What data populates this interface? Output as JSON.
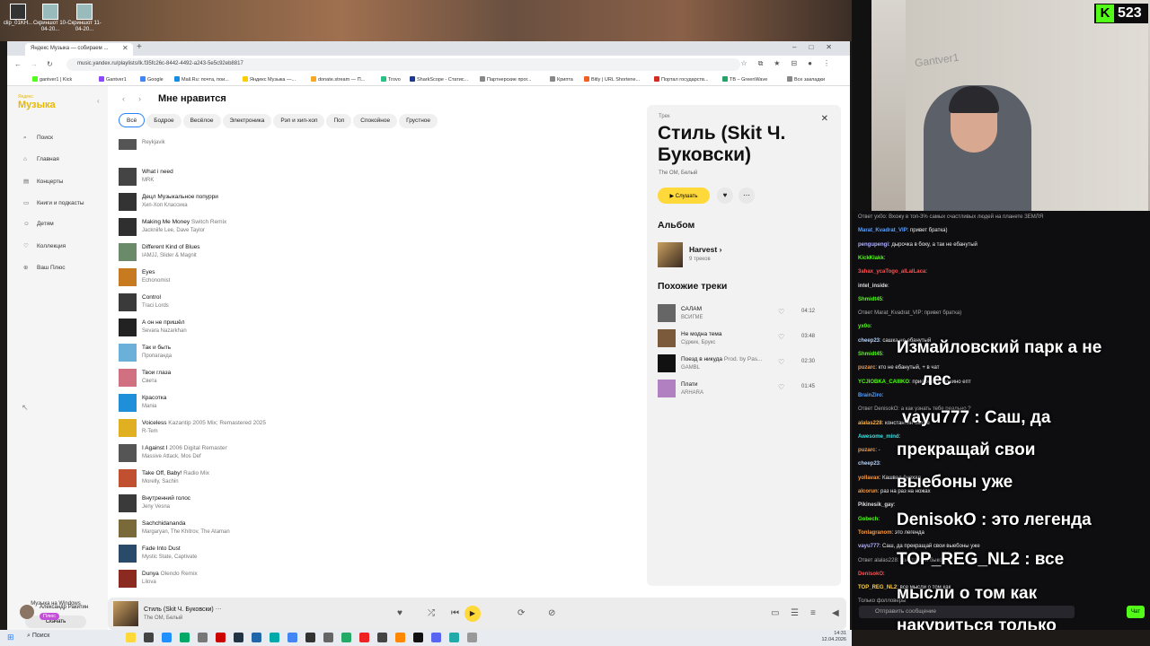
{
  "desktop": {
    "icons": [
      {
        "label": "clip_01KH..."
      },
      {
        "label": "Скриншот 10-04-20..."
      },
      {
        "label": "Скриншот 11-04-20..."
      }
    ]
  },
  "browser": {
    "tab_title": "Яндекс Музыка — собираем ...",
    "url": "music.yandex.ru/playlists/lk.f35fc26c-8442-4492-a243-5e5c92eb8817",
    "bookmarks": [
      "gantver1 | Kick",
      "Gantver1",
      "Google",
      "Mail.Ru: почта, пои...",
      "Яндекс Музыка —...",
      "donate.stream — П...",
      "Trovo",
      "SharkScope - Статис...",
      "Партнерские прог...",
      "Крипта",
      "Bitly | URL Shortene...",
      "Портал государств...",
      "TB – GreenWave",
      "Все закладки"
    ]
  },
  "sidebar": {
    "logo_top": "Яндекс",
    "logo": "Музыка",
    "items": [
      {
        "label": "Поиск",
        "icon": "search-icon"
      },
      {
        "label": "Главная",
        "icon": "home-icon"
      },
      {
        "label": "Концерты",
        "icon": "ticket-icon"
      },
      {
        "label": "Книги и подкасты",
        "icon": "book-icon"
      },
      {
        "label": "Детям",
        "icon": "kids-icon"
      },
      {
        "label": "Коллекция",
        "icon": "heart-icon"
      },
      {
        "label": "Ваш Плюс",
        "icon": "plus-icon"
      }
    ],
    "promo_text": "Музыка на Windows",
    "promo_button": "Скачать",
    "user_name": "Александр Ракитин",
    "user_badge": "Плюс"
  },
  "playlist": {
    "title": "Мне нравится",
    "filters": [
      "Всё",
      "Бодрое",
      "Весёлое",
      "Электроника",
      "Рэп и хип-хоп",
      "Поп",
      "Спокойное",
      "Грустное"
    ],
    "tracks": [
      {
        "title": "",
        "version": "",
        "artist": "Reykjavik",
        "color": "#555"
      },
      {
        "title": "What i need",
        "version": "",
        "artist": "MRK",
        "color": "#444"
      },
      {
        "title": "Децл Музыкальное попурри",
        "version": "",
        "artist": "Хип-Хоп Классика",
        "color": "#333"
      },
      {
        "title": "Making Me Money",
        "version": "Switch Remix",
        "artist": "Jackniife Lee, Dave Taylor",
        "color": "#2f2f2f"
      },
      {
        "title": "Different Kind of Blues",
        "version": "",
        "artist": "IAMJJ, Slider & Magnit",
        "color": "#6a8a6a"
      },
      {
        "title": "Eyes",
        "version": "",
        "artist": "Echonomist",
        "color": "#c87a20"
      },
      {
        "title": "Control",
        "version": "",
        "artist": "Traci Lords",
        "color": "#3a3a3a"
      },
      {
        "title": "А он не пришёл",
        "version": "",
        "artist": "Sevara Nazarkhan",
        "color": "#222"
      },
      {
        "title": "Так и быть",
        "version": "",
        "artist": "Пропаганда",
        "color": "#6ab0d8"
      },
      {
        "title": "Твои глаза",
        "version": "",
        "artist": "Света",
        "color": "#d07080"
      },
      {
        "title": "Красотка",
        "version": "",
        "artist": "Mania",
        "color": "#1e8fd8"
      },
      {
        "title": "Voiceless",
        "version": "Kazantip 2005 Mix; Remastered 2025",
        "artist": "R-Tem",
        "color": "#e0b020"
      },
      {
        "title": "I Against I",
        "version": "2006 Digital Remaster",
        "artist": "Massive Attack, Mos Def",
        "color": "#555"
      },
      {
        "title": "Take Off, Baby!",
        "version": "Radio Mix",
        "artist": "Morelly, Sachin",
        "color": "#c05030"
      },
      {
        "title": "Внутренний голос",
        "version": "",
        "artist": "Jeny Vesna",
        "color": "#3a3a3a"
      },
      {
        "title": "Sachchidananda",
        "version": "",
        "artist": "Margaryan, The Khitrov, The Ataman",
        "color": "#7a6a3a"
      },
      {
        "title": "Fade Into Dust",
        "version": "",
        "artist": "Mystic State, Captivate",
        "color": "#2a4a6a"
      },
      {
        "title": "Dunya",
        "version": "Olendo Remix",
        "artist": "Lilova",
        "color": "#8a2a20"
      }
    ]
  },
  "track_panel": {
    "tag": "Трек",
    "title": "Стиль (Skit Ч. Буковски)",
    "artists": "The OM, Белый",
    "listen": "▶ Слушать",
    "album_header": "Альбом",
    "album_name": "Harvest",
    "album_count": "9 треков",
    "similar_header": "Похожие треки",
    "similar": [
      {
        "title": "САЛАМ",
        "version": "",
        "artist": "ВСИГМЕ",
        "duration": "04:12",
        "color": "#666"
      },
      {
        "title": "Не модна тема",
        "version": "",
        "artist": "Сіджик, Брукс",
        "duration": "03:48",
        "color": "#7a5a3a"
      },
      {
        "title": "Поезд в никуда",
        "version": "Prod. by Pas...",
        "artist": "GAMBL",
        "duration": "02:30",
        "color": "#111"
      },
      {
        "title": "Плати",
        "version": "",
        "artist": "ARHARA",
        "duration": "01:45",
        "color": "#b080c0"
      }
    ]
  },
  "player": {
    "title": "Стиль (Skit Ч. Буковски)",
    "artists": "The OM, Белый"
  },
  "taskbar": {
    "search": "Поиск",
    "time": "14:31",
    "date": "12.04.2026"
  },
  "stream": {
    "viewers": "523",
    "watermark": "Gantver1"
  },
  "chat": {
    "lines": [
      {
        "user": "",
        "text": "Ответ ух0о: Вхожу в топ-3% самых счастливых людей на планете ЗЕМЛЯ",
        "color": "#aaa"
      },
      {
        "user": "Marat_Kvadrat_VIP",
        "text": ": привет братка)",
        "color": "#5aa0ff"
      },
      {
        "user": "pengupengi",
        "text": ": дырочка в боку, а так не ебанутый",
        "color": "#b0b0ff"
      },
      {
        "user": "KickKlakk",
        "text": ":",
        "color": "#53fc18"
      },
      {
        "user": "3ahax_ycaTogo_aILaILaca",
        "text": ":",
        "color": "#ff5050"
      },
      {
        "user": "intel_inside",
        "text": ":",
        "color": "#ddd"
      },
      {
        "user": "Shmidt45",
        "text": ":",
        "color": "#53fc18"
      },
      {
        "user": "",
        "text": "Ответ Marat_Kvadrat_VIP: привет братка)",
        "color": "#aaa"
      },
      {
        "user": "ух0о",
        "text": ":",
        "color": "#53fc18"
      },
      {
        "user": "cheep23",
        "text": ": сашка не ебанутый",
        "color": "#b0d0ff"
      },
      {
        "user": "Shmidt45",
        "text": ":",
        "color": "#53fc18"
      },
      {
        "user": "puzarc",
        "text": ": кто не ебанутый, + в чат",
        "color": "#ff9a40"
      },
      {
        "user": "YCJIOBKA_CAIIIKO",
        "text": ": приезжай в Тушино епт",
        "color": "#53fc18"
      },
      {
        "user": "BrainZiro",
        "text": ":",
        "color": "#5aa0ff"
      },
      {
        "user": "",
        "text": "Ответ DenisokO: а как узнать тебе реально ?",
        "color": "#aaa"
      },
      {
        "user": "alalas228",
        "text": ": константин быков",
        "color": "#ffb040"
      },
      {
        "user": "Awesome_mind",
        "text": ":",
        "color": "#40e0e0"
      },
      {
        "user": "puzarc",
        "text": ": -",
        "color": "#ff9a40"
      },
      {
        "user": "cheep23",
        "text": ":",
        "color": "#b0d0ff"
      },
      {
        "user": "yollavax",
        "text": ": Кашвад ёнехал",
        "color": "#ff9a40"
      },
      {
        "user": "alcorun",
        "text": ": раз на раз на ножах",
        "color": "#ff9a40"
      },
      {
        "user": "Pikinesik_gay",
        "text": ":",
        "color": "#ddd"
      },
      {
        "user": "Gobech",
        "text": ":",
        "color": "#53fc18"
      },
      {
        "user": "Tonlagranom",
        "text": ": это легенда",
        "color": "#ff9a40"
      },
      {
        "user": "vayu777",
        "text": ": Саш, да прекращай свои выебоны уже",
        "color": "#b0b0ff"
      },
      {
        "user": "",
        "text": "Ответ alalas228: константин быков",
        "color": "#aaa"
      },
      {
        "user": "DenisokO",
        "text": ":",
        "color": "#ff5050"
      },
      {
        "user": "TOP_REG_NL2",
        "text": ": все мысли о том как",
        "color": "#ffd040"
      },
      {
        "user": "",
        "text": "Только фолловеры",
        "color": "#aaa"
      }
    ],
    "overlay": [
      {
        "text": "Измайловский парк а не"
      },
      {
        "text": "лес"
      },
      {
        "text": "vayu777 : Саш, да"
      },
      {
        "text": "прекращай свои"
      },
      {
        "text": "выебоны уже"
      },
      {
        "text": "DenisokO : это легенда"
      },
      {
        "text": "TOP_REG_NL2 : все"
      },
      {
        "text": "мысли о том как"
      },
      {
        "text": "накуриться только"
      }
    ],
    "input_placeholder": "Отправить сообщение",
    "send": "Чат"
  }
}
